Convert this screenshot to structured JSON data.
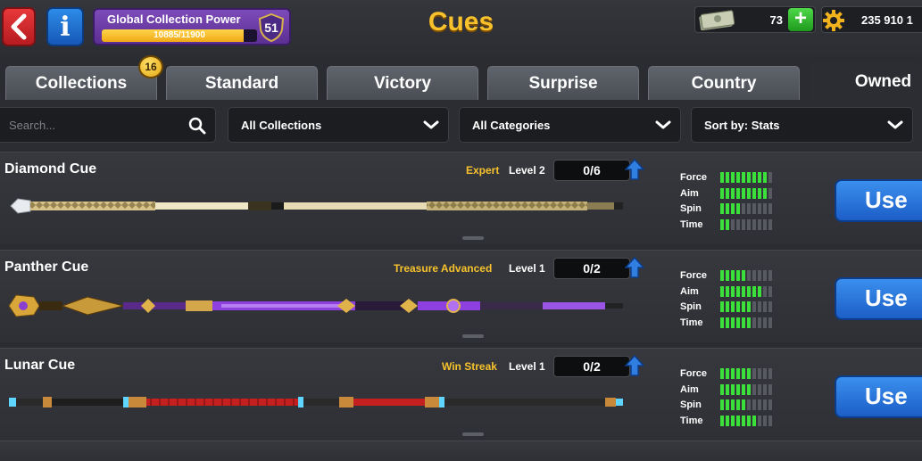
{
  "header": {
    "title": "Cues",
    "collection_power": {
      "label": "Global Collection Power",
      "progress_text": "10885/11900",
      "current": 10885,
      "max": 11900,
      "level": "51"
    },
    "cash": "73",
    "coins": "235 910 1",
    "colors": {
      "title": "#f7c22b",
      "back": "#d6282b",
      "info": "#2474dc",
      "power": "#6a3aa5"
    }
  },
  "tabs": [
    {
      "label": "Collections",
      "badge": "16",
      "active": false
    },
    {
      "label": "Standard",
      "active": false
    },
    {
      "label": "Victory",
      "active": false
    },
    {
      "label": "Surprise",
      "active": false
    },
    {
      "label": "Country",
      "active": false
    },
    {
      "label": "Owned",
      "active": true
    }
  ],
  "filters": {
    "search_placeholder": "Search...",
    "collections": "All Collections",
    "categories": "All Categories",
    "sort": "Sort by: Stats"
  },
  "stat_labels": [
    "Force",
    "Aim",
    "Spin",
    "Time"
  ],
  "cues": [
    {
      "name": "Diamond Cue",
      "category": "Expert",
      "level": "Level 2",
      "progress": "0/6",
      "stats": {
        "force": 9,
        "aim": 9,
        "spin": 4,
        "time": 2
      },
      "use_label": "Use"
    },
    {
      "name": "Panther Cue",
      "category": "Treasure Advanced",
      "level": "Level 1",
      "progress": "0/2",
      "stats": {
        "force": 5,
        "aim": 8,
        "spin": 6,
        "time": 6
      },
      "use_label": "Use"
    },
    {
      "name": "Lunar Cue",
      "category": "Win Streak",
      "level": "Level 1",
      "progress": "0/2",
      "stats": {
        "force": 6,
        "aim": 6,
        "spin": 5,
        "time": 7
      },
      "use_label": "Use"
    }
  ],
  "stat_segments": 10
}
